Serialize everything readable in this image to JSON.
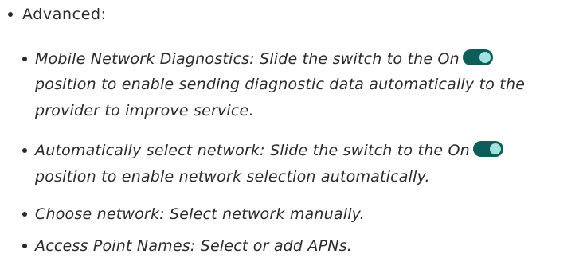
{
  "heading": "Advanced:",
  "items": [
    {
      "line1": "Mobile Network Diagnostics: Slide the switch to the On",
      "line2": "position to enable sending diagnostic data automatically to the",
      "line3": "provider to improve service.",
      "toggle_icon": "toggle-on-icon"
    },
    {
      "line1": "Automatically  select network: Slide the switch to the On",
      "line2": "position to enable network selection automatically.",
      "toggle_icon": "toggle-on-icon"
    },
    {
      "line1": "Choose network: Select network manually."
    },
    {
      "line1": "Access Point Names: Select or add APNs."
    }
  ],
  "colors": {
    "toggle_track": "#0b5e5a",
    "toggle_knob": "#9fe5de",
    "text": "#2a2a2a"
  }
}
